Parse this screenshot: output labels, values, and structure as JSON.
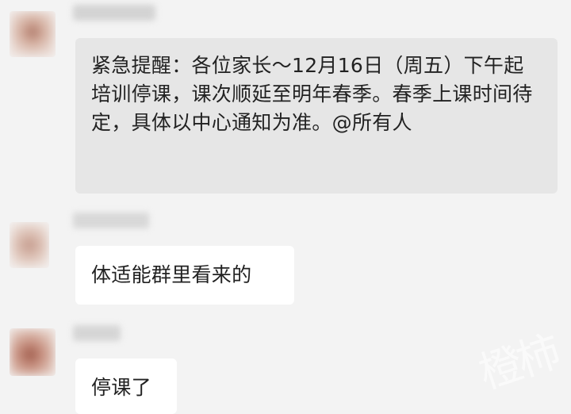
{
  "messages": [
    {
      "text": "紧急提醒：各位家长～12月16日（周五）下午起培训停课，课次顺延至明年春季。春季上课时间待定，具体以中心通知为准。@所有人",
      "bubble_color": "#e6e6e6"
    },
    {
      "text": "体适能群里看来的",
      "bubble_color": "#ffffff"
    },
    {
      "text": "停课了",
      "bubble_color": "#ffffff"
    }
  ],
  "watermark": {
    "text": "橙柿"
  },
  "colors": {
    "background": "#f3f3f3",
    "text": "#222222"
  }
}
